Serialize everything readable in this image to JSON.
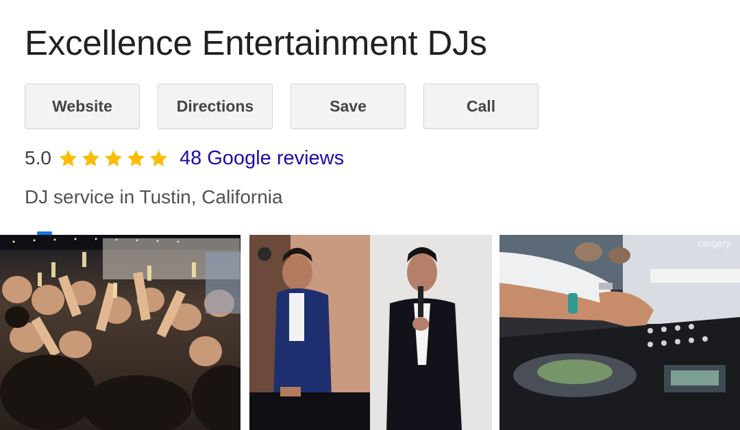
{
  "business": {
    "name": "Excellence Entertainment DJs",
    "category": "DJ service in Tustin, California"
  },
  "actions": {
    "website": "Website",
    "directions": "Directions",
    "save": "Save",
    "call": "Call"
  },
  "rating": {
    "value": "5.0",
    "stars": 5,
    "reviews_link": "48 Google reviews"
  },
  "photos": {
    "watermark": "rangery"
  },
  "colors": {
    "star": "#fbbc04",
    "link": "#1a0dab",
    "button_bg": "#f3f3f3"
  }
}
